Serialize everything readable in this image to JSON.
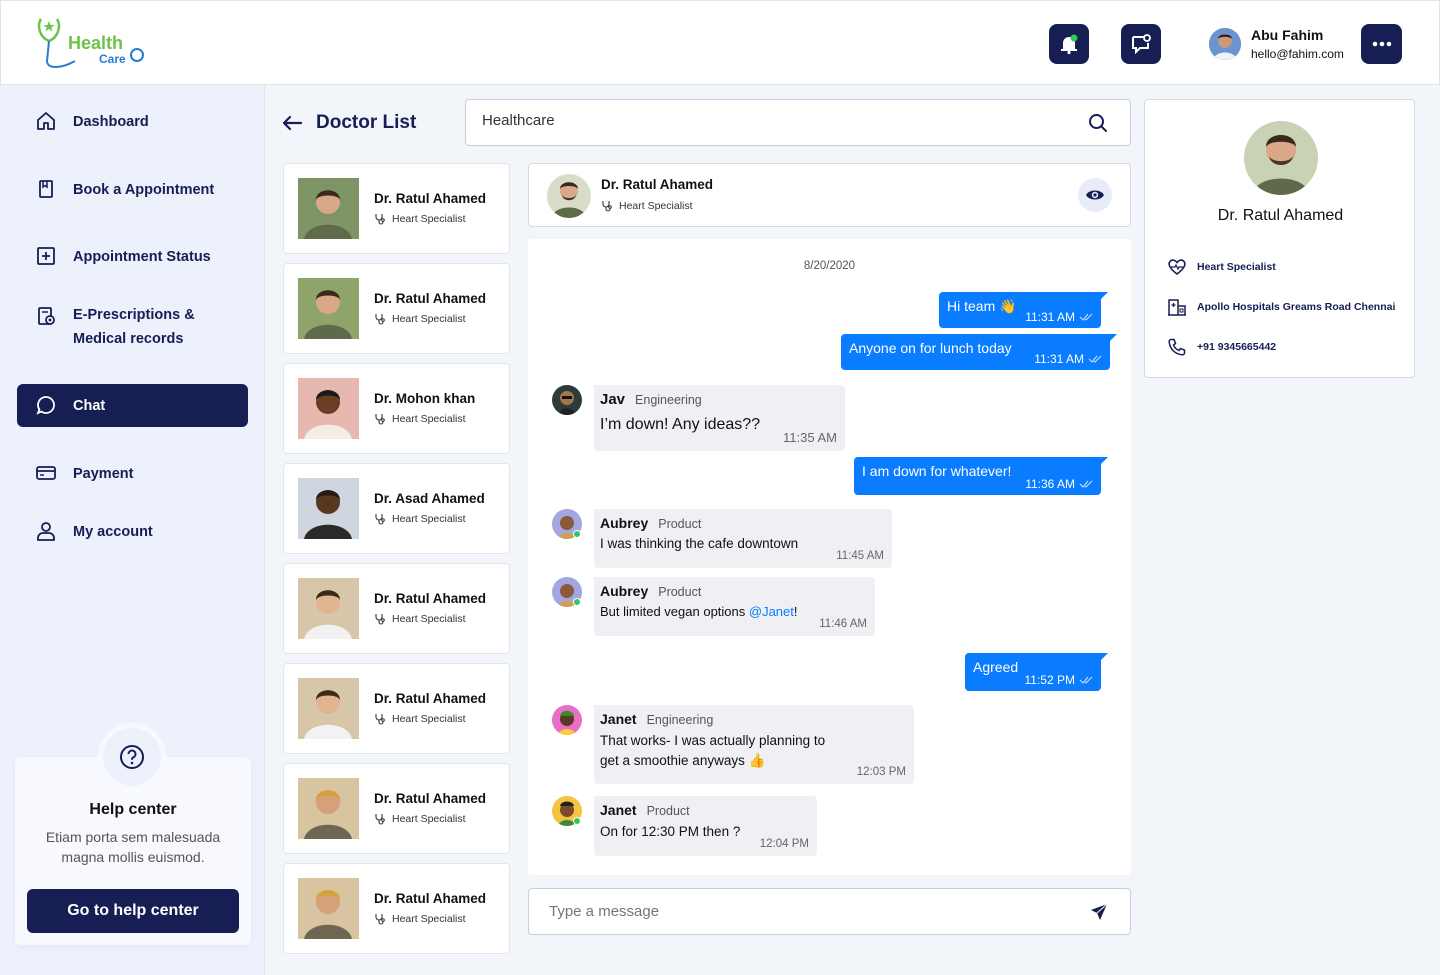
{
  "brand": {
    "line1": "Health",
    "line2": "Care"
  },
  "user": {
    "name": "Abu Fahim",
    "email": "hello@fahim.com"
  },
  "colors": {
    "navy": "#161e54",
    "bubble": "#0a7cff",
    "online": "#2ec95c",
    "logo_green": "#6cc24a",
    "logo_blue": "#2a7bd6"
  },
  "sidebar": {
    "items": [
      {
        "label": "Dashboard",
        "icon": "home-icon"
      },
      {
        "label": "Book a Appointment",
        "icon": "bookmark-icon"
      },
      {
        "label": "Appointment Status",
        "icon": "plus-square-icon"
      },
      {
        "label": "E-Prescriptions &",
        "label2": "Medical records",
        "icon": "prescription-icon"
      },
      {
        "label": "Chat",
        "icon": "chat-icon",
        "active": true
      },
      {
        "label": "Payment",
        "icon": "card-icon"
      },
      {
        "label": "My account",
        "icon": "user-icon"
      }
    ]
  },
  "help": {
    "title": "Help center",
    "desc": "Etiam porta sem malesuada magna mollis euismod.",
    "button": "Go to help center"
  },
  "doctor_list": {
    "title": "Doctor List"
  },
  "search": {
    "value": "Healthcare"
  },
  "doctors": [
    {
      "name": "Dr. Ratul Ahamed",
      "specialty": "Heart Specialist"
    },
    {
      "name": "Dr. Ratul Ahamed",
      "specialty": "Heart Specialist"
    },
    {
      "name": "Dr. Mohon khan",
      "specialty": "Heart Specialist"
    },
    {
      "name": "Dr. Asad Ahamed",
      "specialty": "Heart Specialist"
    },
    {
      "name": "Dr. Ratul Ahamed",
      "specialty": "Heart Specialist"
    },
    {
      "name": "Dr. Ratul Ahamed",
      "specialty": "Heart Specialist"
    },
    {
      "name": "Dr. Ratul Ahamed",
      "specialty": "Heart Specialist"
    },
    {
      "name": "Dr. Ratul Ahamed",
      "specialty": "Heart Specialist"
    }
  ],
  "chat": {
    "header": {
      "name": "Dr. Ratul Ahamed",
      "specialty": "Heart Specialist"
    },
    "date": "8/20/2020",
    "messages": [
      {
        "text": "Hi team 👋",
        "time": "11:31 AM"
      },
      {
        "text": "Anyone on for lunch today",
        "time": "11:31 AM"
      },
      {
        "sender": "Jav",
        "dept": "Engineering",
        "text": "I’m down! Any ideas??",
        "time": "11:35 AM"
      },
      {
        "text": "I am down for whatever!",
        "time": "11:36 AM"
      },
      {
        "sender": "Aubrey",
        "dept": "Product",
        "text": "I was thinking the cafe downtown",
        "time": "11:45 AM"
      },
      {
        "sender": "Aubrey",
        "dept": "Product",
        "text": "But limited vegan options ",
        "mention": "@Janet",
        "suffix": "!",
        "time": "11:46 AM"
      },
      {
        "text": "Agreed",
        "time": "11:52 PM"
      },
      {
        "sender": "Janet",
        "dept": "Engineering",
        "text": "That works- I was actually planning to",
        "text2": "get a smoothie anyways 👍",
        "time": "12:03 PM"
      },
      {
        "sender": "Janet",
        "dept": "Product",
        "text": "On for 12:30 PM then ?",
        "time": "12:04 PM"
      }
    ],
    "composer_placeholder": "Type a message"
  },
  "profile": {
    "name": "Dr. Ratul Ahamed",
    "specialty": "Heart Specialist",
    "hospital": "Apollo Hospitals Greams Road Chennai",
    "phone": "+91 9345665442"
  }
}
